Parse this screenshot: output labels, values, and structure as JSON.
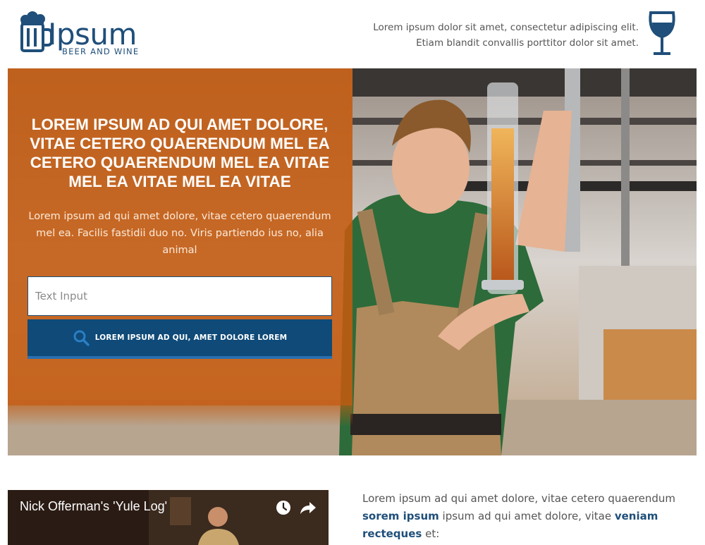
{
  "header": {
    "logo_text": "Ipsum",
    "logo_subtext": "BEER AND WINE",
    "tagline_line1": "Lorem ipsum dolor sit amet, consectetur adipiscing elit.",
    "tagline_line2": "Etiam blandit convallis porttitor dolor sit amet."
  },
  "hero": {
    "title": "LOREM IPSUM AD QUI AMET DOLORE, VITAE CETERO QUAERENDUM MEL EA CETERO QUAERENDUM MEL EA VITAE MEL EA VITAE MEL EA VITAE",
    "text": "Lorem ipsum ad qui amet dolore, vitae cetero quaerendum mel ea. Facilis fastidii duo no. Viris partiendo ius no, alia animal",
    "input_placeholder": "Text Input",
    "button_label": "LOREM IPSUM AD QUI, AMET DOLORE LOREM"
  },
  "video": {
    "title": "Nick Offerman's 'Yule Log'"
  },
  "content": {
    "p1": "Lorem ipsum ad qui amet dolore, vitae cetero quaerendum",
    "bold1": "sorem ipsum",
    "p2": " ipsum ad qui amet dolore, vitae ",
    "bold2": "veniam recteques",
    "p3": " et:"
  },
  "colors": {
    "brand_blue": "#1f4f7a",
    "button_blue": "#0f4a78",
    "hero_orange": "#c45a0f"
  },
  "icons": [
    "beer-mug-icon",
    "wine-glass-icon",
    "search-icon",
    "clock-icon",
    "share-icon"
  ]
}
